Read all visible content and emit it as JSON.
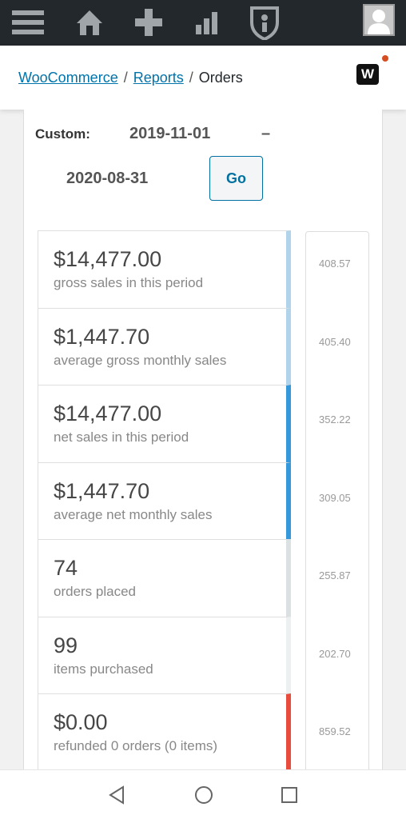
{
  "topbar": {
    "icons": [
      "menu-icon",
      "home-icon",
      "plus-icon",
      "stats-icon",
      "shield-icon"
    ],
    "avatar": "avatar"
  },
  "breadcrumb": {
    "items": [
      "WooCommerce",
      "Reports"
    ],
    "current": "Orders",
    "separator": "/"
  },
  "colors": {
    "accent": "#0073aa",
    "notification": "#d54e21"
  },
  "range": {
    "label": "Custom:",
    "from": "2019-11-01",
    "dash": "–",
    "to": "2020-08-31",
    "go": "Go"
  },
  "legend": [
    {
      "amount": "$14,477.00",
      "desc": "gross sales in this period",
      "color": "#b1d4ea"
    },
    {
      "amount": "$1,447.70",
      "desc": "average gross monthly sales",
      "color": "#b1d4ea"
    },
    {
      "amount": "$14,477.00",
      "desc": "net sales in this period",
      "color": "#3498db"
    },
    {
      "amount": "$1,447.70",
      "desc": "average net monthly sales",
      "color": "#3498db"
    },
    {
      "amount": "74",
      "desc": "orders placed",
      "color": "#dbe1e3"
    },
    {
      "amount": "99",
      "desc": "items purchased",
      "color": "#ecf0f1"
    },
    {
      "amount": "$0.00",
      "desc": "refunded 0 orders (0 items)",
      "color": "#e74c3c"
    }
  ],
  "axis_ticks": [
    "408.57",
    "405.40",
    "352.22",
    "309.05",
    "255.87",
    "202.70",
    "859.52"
  ]
}
